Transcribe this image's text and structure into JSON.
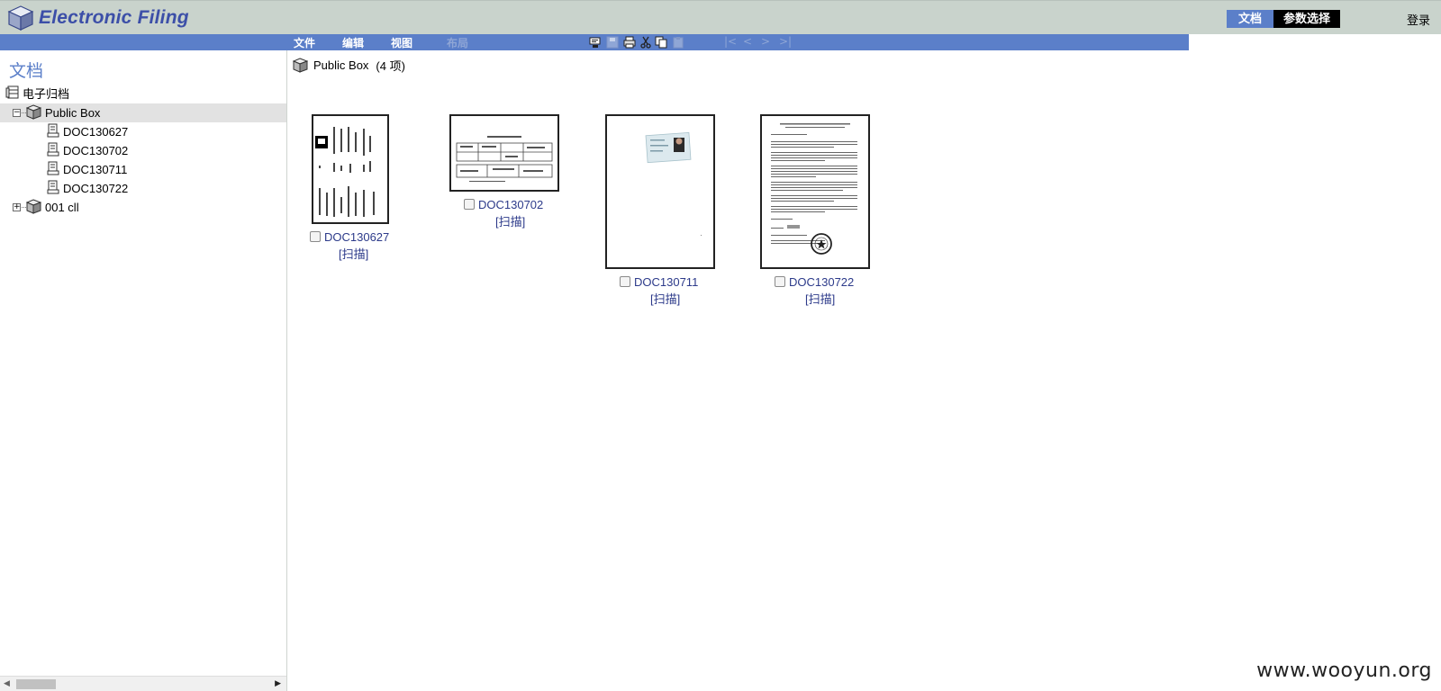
{
  "header": {
    "app_title": "Electronic Filing",
    "tabs": [
      {
        "label": "文档",
        "active": true
      },
      {
        "label": "参数选择",
        "active": false
      }
    ],
    "login_label": "登录"
  },
  "menu": {
    "file": "文件",
    "edit": "编辑",
    "view": "视图",
    "layout": "布局"
  },
  "toolbar": {
    "icons": [
      "scan-icon",
      "save-icon",
      "print-icon",
      "cut-icon",
      "copy-icon",
      "paste-icon"
    ],
    "nav": [
      "|<",
      "<",
      ">",
      ">|"
    ]
  },
  "sidebar": {
    "title": "文档",
    "tree": {
      "root": "电子归档",
      "public_box": "Public Box",
      "docs": [
        "DOC130627",
        "DOC130702",
        "DOC130711",
        "DOC130722"
      ],
      "other_box": "001 cll"
    }
  },
  "main": {
    "location": "Public Box",
    "count": "(4 项)",
    "documents": [
      {
        "name": "DOC130627",
        "action": "[扫描]"
      },
      {
        "name": "DOC130702",
        "action": "[扫描]"
      },
      {
        "name": "DOC130711",
        "action": "[扫描]"
      },
      {
        "name": "DOC130722",
        "action": "[扫描]"
      }
    ]
  },
  "watermark": "www.wooyun.org",
  "colors": {
    "accent": "#5b7fc9",
    "header_bg": "#c9d3cc",
    "logo_text": "#3c4fa8",
    "link": "#2c3a8a"
  }
}
